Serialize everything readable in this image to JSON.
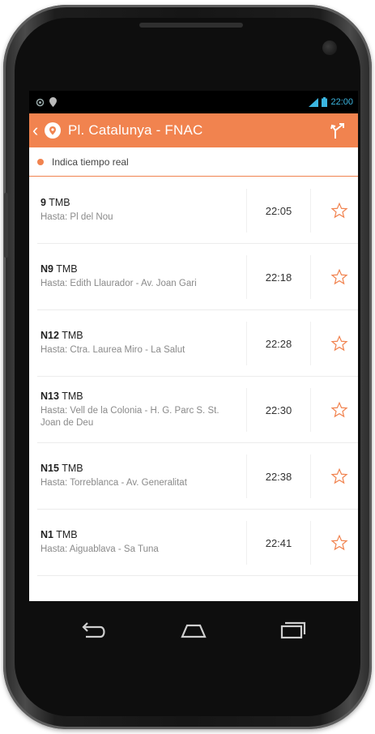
{
  "status_bar": {
    "time": "22:00",
    "icons": [
      "location-icon",
      "map-pin-icon",
      "signal-icon",
      "battery-icon"
    ]
  },
  "app_bar": {
    "title": "Pl. Catalunya - FNAC",
    "icons": [
      "back-icon",
      "app-logo-icon",
      "route-icon"
    ]
  },
  "legend": {
    "text": "Indica tiempo real",
    "color": "#f1834f"
  },
  "departures": [
    {
      "line": "9",
      "operator": "TMB",
      "destination": "Hasta: Pl del Nou",
      "time": "22:05"
    },
    {
      "line": "N9",
      "operator": "TMB",
      "destination": "Hasta: Edith Llaurador - Av. Joan Gari",
      "time": "22:18"
    },
    {
      "line": "N12",
      "operator": "TMB",
      "destination": "Hasta: Ctra. Laurea Miro - La Salut",
      "time": "22:28"
    },
    {
      "line": "N13",
      "operator": "TMB",
      "destination": "Hasta: Vell de la Colonia - H. G. Parc S. St. Joan de Deu",
      "time": "22:30"
    },
    {
      "line": "N15",
      "operator": "TMB",
      "destination": "Hasta: Torreblanca - Av. Generalitat",
      "time": "22:38"
    },
    {
      "line": "N1",
      "operator": "TMB",
      "destination": "Hasta: Aiguablava - Sa Tuna",
      "time": "22:41"
    }
  ],
  "nav_bar": {
    "icons": [
      "back-nav-icon",
      "home-nav-icon",
      "recents-nav-icon"
    ]
  },
  "colors": {
    "accent": "#f1834f",
    "status_blue": "#3bb5e0"
  }
}
